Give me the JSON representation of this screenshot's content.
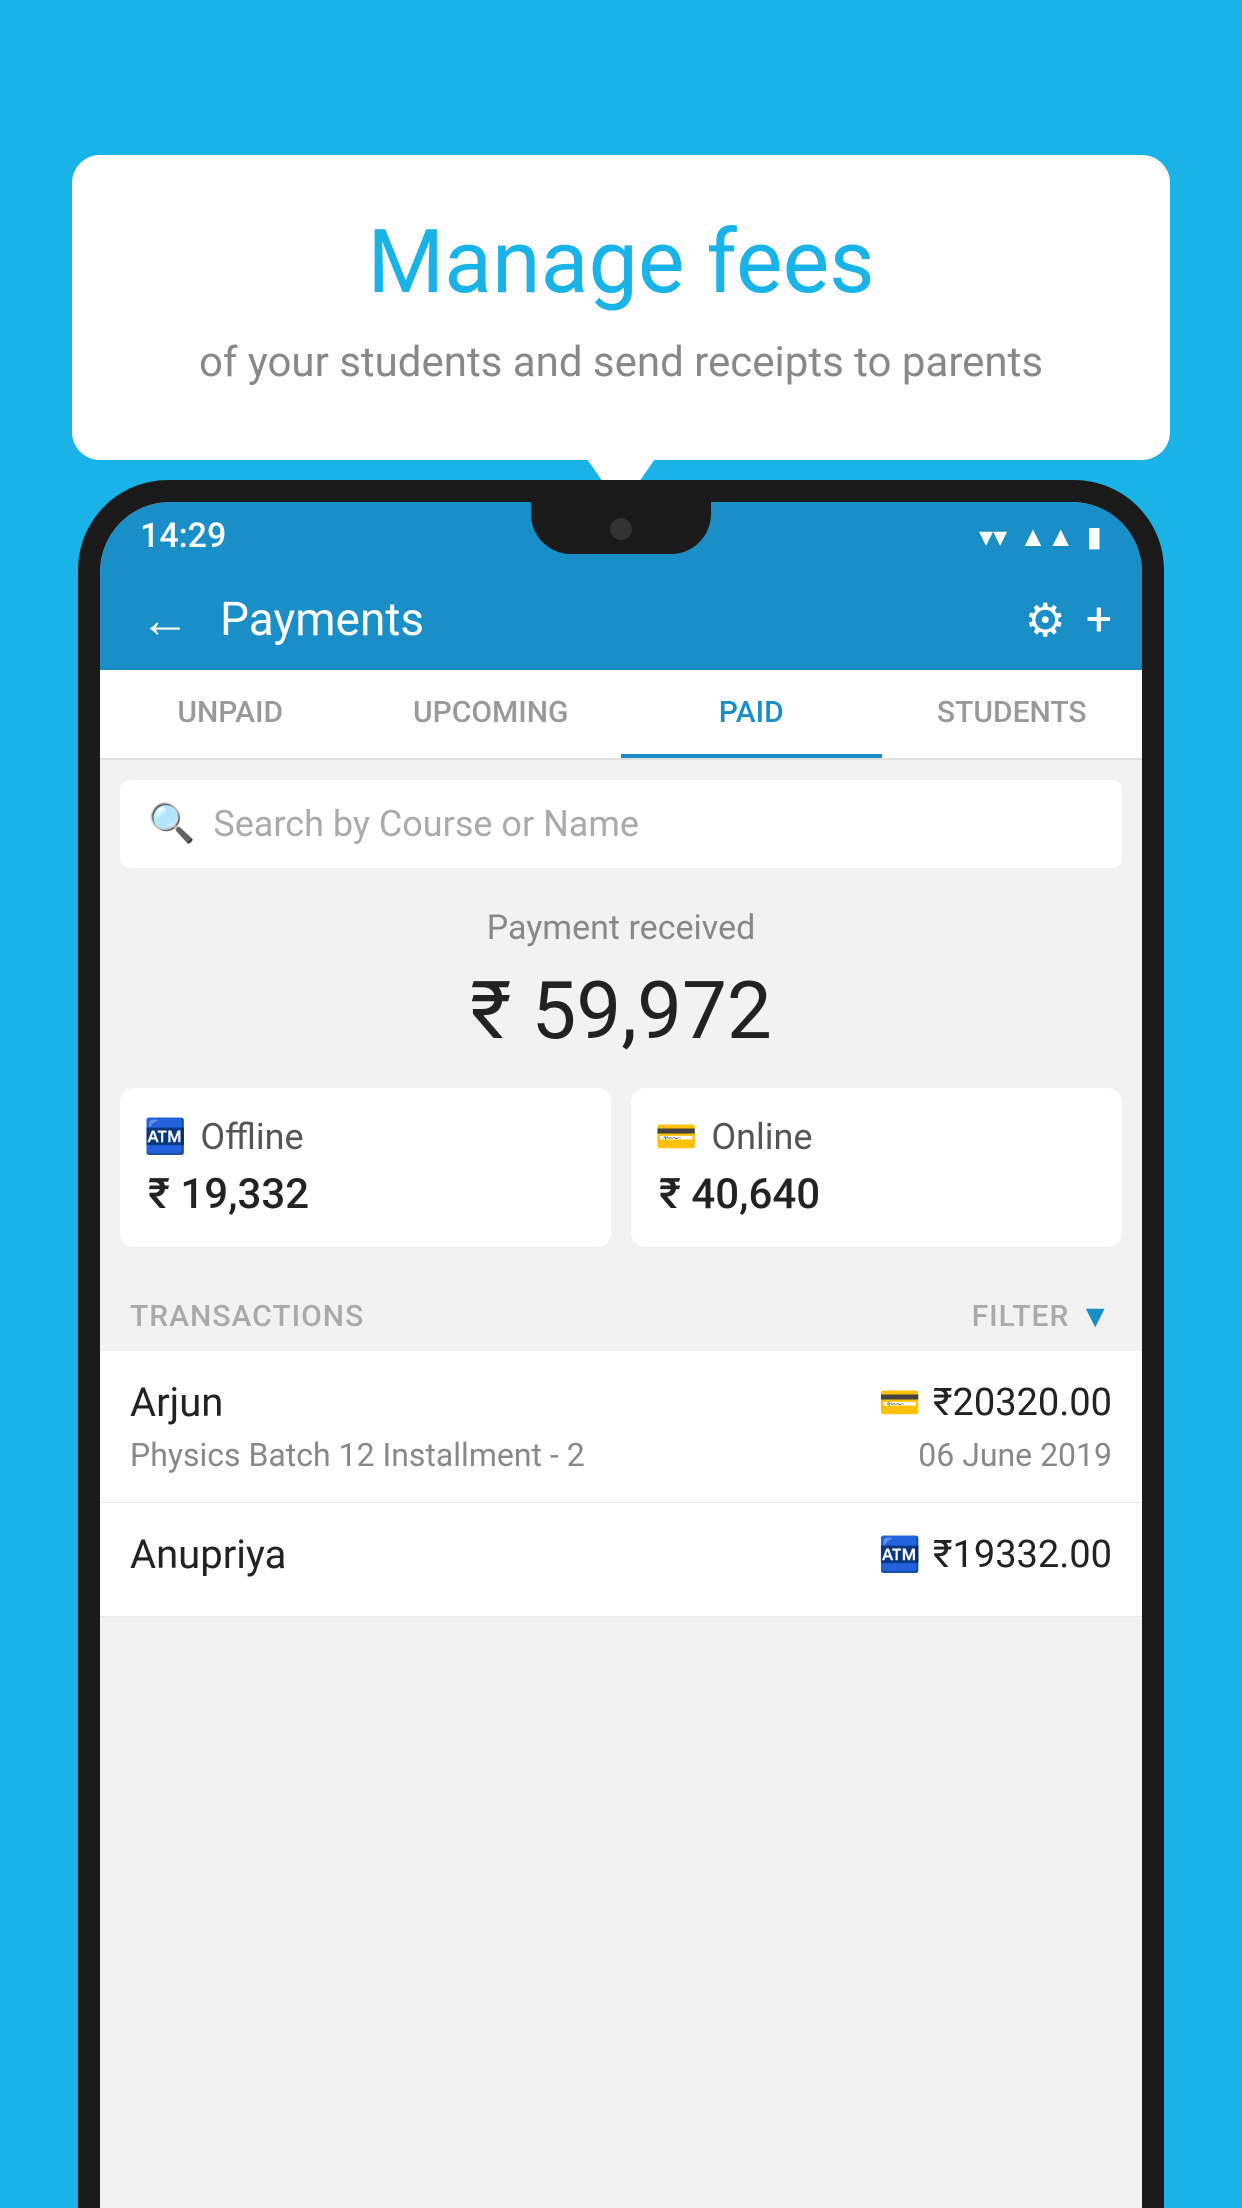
{
  "background_color": "#1ab3e8",
  "bubble": {
    "title": "Manage fees",
    "subtitle": "of your students and send receipts to parents"
  },
  "status_bar": {
    "time": "14:29",
    "wifi": "▼",
    "signal": "▲",
    "battery": "▮"
  },
  "header": {
    "title": "Payments",
    "back_label": "←",
    "gear_label": "⚙",
    "plus_label": "+"
  },
  "tabs": [
    {
      "id": "unpaid",
      "label": "UNPAID",
      "active": false
    },
    {
      "id": "upcoming",
      "label": "UPCOMING",
      "active": false
    },
    {
      "id": "paid",
      "label": "PAID",
      "active": true
    },
    {
      "id": "students",
      "label": "STUDENTS",
      "active": false
    }
  ],
  "search": {
    "placeholder": "Search by Course or Name"
  },
  "payment": {
    "label": "Payment received",
    "amount": "₹ 59,972",
    "offline": {
      "label": "Offline",
      "amount": "₹ 19,332"
    },
    "online": {
      "label": "Online",
      "amount": "₹ 40,640"
    }
  },
  "transactions": {
    "label": "TRANSACTIONS",
    "filter_label": "FILTER",
    "rows": [
      {
        "name": "Arjun",
        "course": "Physics Batch 12 Installment - 2",
        "amount": "₹20320.00",
        "date": "06 June 2019",
        "payment_type": "online"
      },
      {
        "name": "Anupriya",
        "course": "",
        "amount": "₹19332.00",
        "date": "",
        "payment_type": "offline"
      }
    ]
  }
}
